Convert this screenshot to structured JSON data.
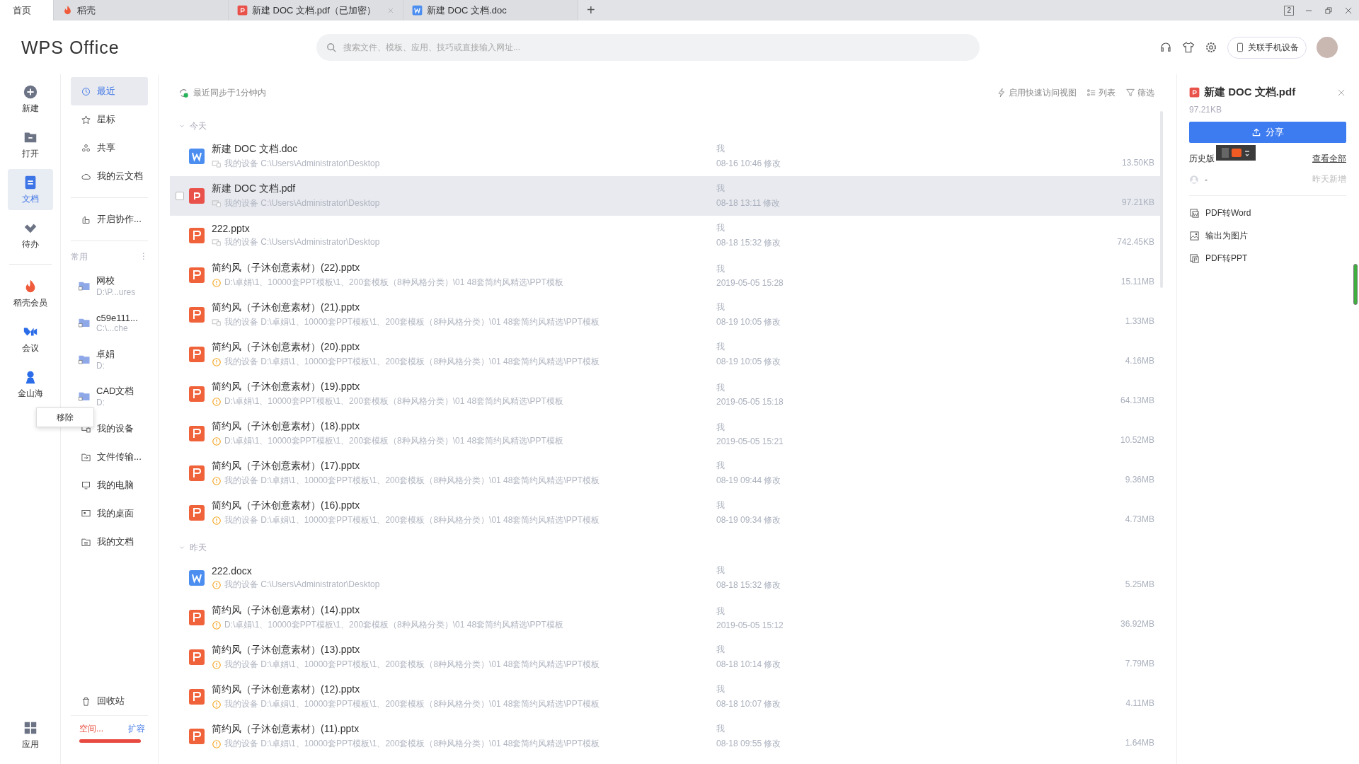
{
  "tabs": [
    {
      "label": "首页",
      "kind": "home",
      "selected": true,
      "closable": false
    },
    {
      "label": "稻壳",
      "kind": "daoke",
      "selected": false,
      "closable": false
    },
    {
      "label": "新建 DOC 文档.pdf（已加密）",
      "kind": "pdf",
      "selected": false,
      "closable": true
    },
    {
      "label": "新建 DOC 文档.doc",
      "kind": "word",
      "selected": false,
      "closable": false
    }
  ],
  "new_tab": "+",
  "window_badge": "2",
  "header": {
    "logo": "WPS Office",
    "search": {
      "placeholder": "搜索文件、模板、应用、技巧或直接输入网址..."
    },
    "phone_button": "关联手机设备"
  },
  "nav": [
    {
      "label": "新建",
      "selected": false
    },
    {
      "label": "打开",
      "selected": false
    },
    {
      "label": "文档",
      "selected": true
    },
    {
      "label": "待办",
      "selected": false
    },
    {
      "label": "稻壳会员",
      "selected": false
    },
    {
      "label": "会议",
      "selected": false
    },
    {
      "label": "金山海",
      "selected": false
    }
  ],
  "nav_bottom": {
    "label": "应用"
  },
  "context_menu": {
    "items": [
      "移除"
    ]
  },
  "side": {
    "primary": [
      {
        "label": "最近",
        "selected": true
      },
      {
        "label": "星标",
        "selected": false
      },
      {
        "label": "共享",
        "selected": false
      },
      {
        "label": "我的云文档",
        "selected": false
      }
    ],
    "collaborate": {
      "label": "开启协作..."
    },
    "frequent": {
      "title": "常用",
      "menu": "⋮",
      "folders": [
        {
          "name": "网校",
          "path": "D:\\P...ures"
        },
        {
          "name": "c59e111...",
          "path": "C:\\...che"
        },
        {
          "name": "卓娟",
          "path": "D:"
        },
        {
          "name": "CAD文档",
          "path": "D:"
        }
      ]
    },
    "locations": [
      {
        "label": "我的设备"
      },
      {
        "label": "文件传输..."
      },
      {
        "label": "我的电脑"
      },
      {
        "label": "我的桌面"
      },
      {
        "label": "我的文档"
      }
    ],
    "recycle": {
      "label": "回收站"
    },
    "storage": {
      "used": "空间...",
      "expand": "扩容",
      "level": 1
    }
  },
  "main": {
    "sync": "最近同步于1分钟内",
    "toolbar": [
      {
        "label": "启用快速访问视图"
      },
      {
        "label": "列表"
      },
      {
        "label": "筛选"
      }
    ],
    "groups": [
      {
        "title": "今天",
        "expanded": true,
        "files": [
          {
            "name": "新建 DOC 文档.doc",
            "kind": "word",
            "warning": false,
            "path": "我的设备 C:\\Users\\Administrator\\Desktop",
            "owner": "我",
            "time": "08-16 10:46 修改",
            "size": "13.50KB",
            "selected": false
          },
          {
            "name": "新建 DOC 文档.pdf",
            "kind": "pdf",
            "warning": false,
            "path": "我的设备 C:\\Users\\Administrator\\Desktop",
            "owner": "我",
            "time": "08-18 13:11 修改",
            "size": "97.21KB",
            "selected": true
          },
          {
            "name": "222.pptx",
            "kind": "ppt",
            "warning": false,
            "path": "我的设备 C:\\Users\\Administrator\\Desktop",
            "owner": "我",
            "time": "08-18 15:32 修改",
            "size": "742.45KB",
            "selected": false
          },
          {
            "name": "简约风（子沐创意素材）(22).pptx",
            "kind": "ppt",
            "warning": true,
            "path": "D:\\卓娟\\1、10000套PPT模板\\1、200套模板（8种风格分类）\\01 48套简约风精选\\PPT模板",
            "owner": "我",
            "time": "2019-05-05 15:28",
            "size": "15.11MB",
            "selected": false
          },
          {
            "name": "简约风（子沐创意素材）(21).pptx",
            "kind": "ppt",
            "warning": false,
            "path": "我的设备 D:\\卓娟\\1、10000套PPT模板\\1、200套模板（8种风格分类）\\01 48套简约风精选\\PPT模板",
            "owner": "我",
            "time": "08-19 10:05 修改",
            "size": "1.33MB",
            "selected": false
          },
          {
            "name": "简约风（子沐创意素材）(20).pptx",
            "kind": "ppt",
            "warning": true,
            "path": "我的设备 D:\\卓娟\\1、10000套PPT模板\\1、200套模板（8种风格分类）\\01 48套简约风精选\\PPT模板",
            "owner": "我",
            "time": "08-19 10:05 修改",
            "size": "4.16MB",
            "selected": false
          },
          {
            "name": "简约风（子沐创意素材）(19).pptx",
            "kind": "ppt",
            "warning": true,
            "path": "D:\\卓娟\\1、10000套PPT模板\\1、200套模板（8种风格分类）\\01 48套简约风精选\\PPT模板",
            "owner": "我",
            "time": "2019-05-05 15:18",
            "size": "64.13MB",
            "selected": false
          },
          {
            "name": "简约风（子沐创意素材）(18).pptx",
            "kind": "ppt",
            "warning": true,
            "path": "D:\\卓娟\\1、10000套PPT模板\\1、200套模板（8种风格分类）\\01 48套简约风精选\\PPT模板",
            "owner": "我",
            "time": "2019-05-05 15:21",
            "size": "10.52MB",
            "selected": false
          },
          {
            "name": "简约风（子沐创意素材）(17).pptx",
            "kind": "ppt",
            "warning": true,
            "path": "我的设备 D:\\卓娟\\1、10000套PPT模板\\1、200套模板（8种风格分类）\\01 48套简约风精选\\PPT模板",
            "owner": "我",
            "time": "08-19 09:44 修改",
            "size": "9.36MB",
            "selected": false
          },
          {
            "name": "简约风（子沐创意素材）(16).pptx",
            "kind": "ppt",
            "warning": true,
            "path": "我的设备 D:\\卓娟\\1、10000套PPT模板\\1、200套模板（8种风格分类）\\01 48套简约风精选\\PPT模板",
            "owner": "我",
            "time": "08-19 09:34 修改",
            "size": "4.73MB",
            "selected": false
          }
        ]
      },
      {
        "title": "昨天",
        "expanded": true,
        "files": [
          {
            "name": "222.docx",
            "kind": "word",
            "warning": true,
            "path": "我的设备 C:\\Users\\Administrator\\Desktop",
            "owner": "我",
            "time": "08-18 15:32 修改",
            "size": "5.25MB",
            "selected": false
          },
          {
            "name": "简约风（子沐创意素材）(14).pptx",
            "kind": "ppt",
            "warning": true,
            "path": "D:\\卓娟\\1、10000套PPT模板\\1、200套模板（8种风格分类）\\01 48套简约风精选\\PPT模板",
            "owner": "我",
            "time": "2019-05-05 15:12",
            "size": "36.92MB",
            "selected": false
          },
          {
            "name": "简约风（子沐创意素材）(13).pptx",
            "kind": "ppt",
            "warning": true,
            "path": "我的设备 D:\\卓娟\\1、10000套PPT模板\\1、200套模板（8种风格分类）\\01 48套简约风精选\\PPT模板",
            "owner": "我",
            "time": "08-18 10:14 修改",
            "size": "7.79MB",
            "selected": false
          },
          {
            "name": "简约风（子沐创意素材）(12).pptx",
            "kind": "ppt",
            "warning": true,
            "path": "我的设备 D:\\卓娟\\1、10000套PPT模板\\1、200套模板（8种风格分类）\\01 48套简约风精选\\PPT模板",
            "owner": "我",
            "time": "08-18 10:07 修改",
            "size": "4.11MB",
            "selected": false
          },
          {
            "name": "简约风（子沐创意素材）(11).pptx",
            "kind": "ppt",
            "warning": true,
            "path": "我的设备 D:\\卓娟\\1、10000套PPT模板\\1、200套模板（8种风格分类）\\01 48套简约风精选\\PPT模板",
            "owner": "我",
            "time": "08-18 09:55 修改",
            "size": "1.64MB",
            "selected": false
          }
        ]
      }
    ]
  },
  "panel": {
    "kind": "pdf",
    "title": "新建 DOC 文档.pdf",
    "size": "97.21KB",
    "share": "分享",
    "history_label": "历史版",
    "view_all": "查看全部",
    "versions": [
      {
        "author": "-",
        "note": "昨天新增"
      }
    ],
    "actions": [
      {
        "label": "PDF转Word"
      },
      {
        "label": "输出为图片"
      },
      {
        "label": "PDF转PPT"
      }
    ]
  }
}
